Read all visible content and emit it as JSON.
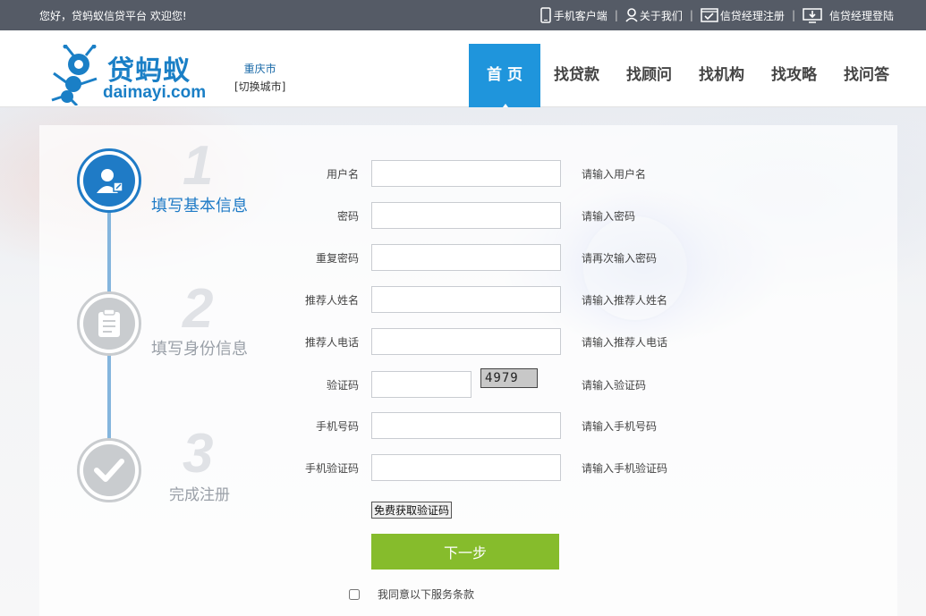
{
  "topbar": {
    "welcome": "您好，贷蚂蚁信贷平台  欢迎您!",
    "links": [
      {
        "label": "手机客户端",
        "icon": "mobile-icon"
      },
      {
        "label": "关于我们",
        "icon": "user-icon"
      },
      {
        "label": "信贷经理注册",
        "icon": "register-icon"
      },
      {
        "label": "信贷经理登陆",
        "icon": "login-icon"
      }
    ],
    "separator": "|"
  },
  "header": {
    "logo_cn": "贷蚂蚁",
    "logo_en": "daimayi.com",
    "city": "重庆市",
    "city_switch": "[切换城市]",
    "nav": [
      "首 页",
      "找贷款",
      "找顾问",
      "找机构",
      "找攻略",
      "找问答"
    ]
  },
  "steps": [
    {
      "number": "1",
      "label": "填写基本信息",
      "active": true
    },
    {
      "number": "2",
      "label": "填写身份信息",
      "active": false
    },
    {
      "number": "3",
      "label": "完成注册",
      "active": false
    }
  ],
  "form": {
    "fields": [
      {
        "label": "用户名",
        "hint": "请输入用户名",
        "value": ""
      },
      {
        "label": "密码",
        "hint": "请输入密码",
        "value": ""
      },
      {
        "label": "重复密码",
        "hint": "请再次输入密码",
        "value": ""
      },
      {
        "label": "推荐人姓名",
        "hint": "请输入推荐人姓名",
        "value": ""
      },
      {
        "label": "推荐人电话",
        "hint": "请输入推荐人电话",
        "value": ""
      },
      {
        "label": "验证码",
        "hint": "请输入验证码",
        "value": ""
      },
      {
        "label": "手机号码",
        "hint": "请输入手机号码",
        "value": ""
      },
      {
        "label": "手机验证码",
        "hint": "请输入手机验证码",
        "value": ""
      }
    ],
    "captcha_text": "4979",
    "sms_button": "免费获取验证码",
    "next_button": "下一步",
    "agree_label": "我同意以下服务条款"
  },
  "colors": {
    "topbar": "#555b66",
    "brand_blue": "#1f95dc",
    "next_green": "#86bc2c"
  }
}
